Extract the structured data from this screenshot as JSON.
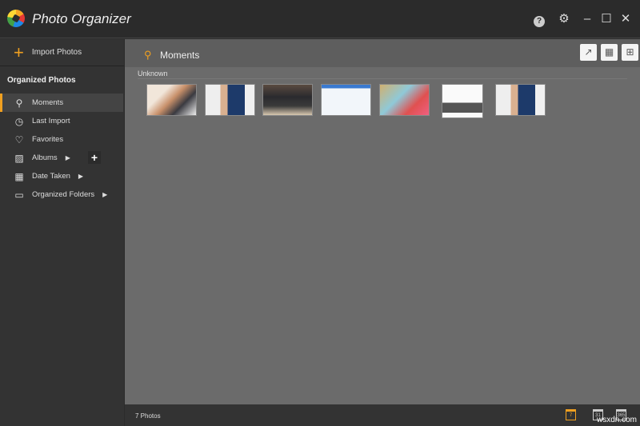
{
  "app": {
    "title": "Photo Organizer"
  },
  "sidebar": {
    "import_label": "Import Photos",
    "section_title": "Organized Photos",
    "items": [
      {
        "label": "Moments",
        "icon": "balloon-icon"
      },
      {
        "label": "Last Import",
        "icon": "clock-icon"
      },
      {
        "label": "Favorites",
        "icon": "heart-icon"
      },
      {
        "label": "Albums",
        "icon": "image-icon"
      },
      {
        "label": "Date Taken",
        "icon": "calendar-icon"
      },
      {
        "label": "Organized Folders",
        "icon": "folder-icon"
      }
    ]
  },
  "main": {
    "title": "Moments",
    "group_label": "Unknown",
    "photo_count": 7
  },
  "footer": {
    "status": "7 Photos",
    "day_label": "7",
    "month_label": "31",
    "year_label": "365"
  },
  "watermark": "wsxdn.com",
  "colors": {
    "accent": "#f0a020"
  }
}
